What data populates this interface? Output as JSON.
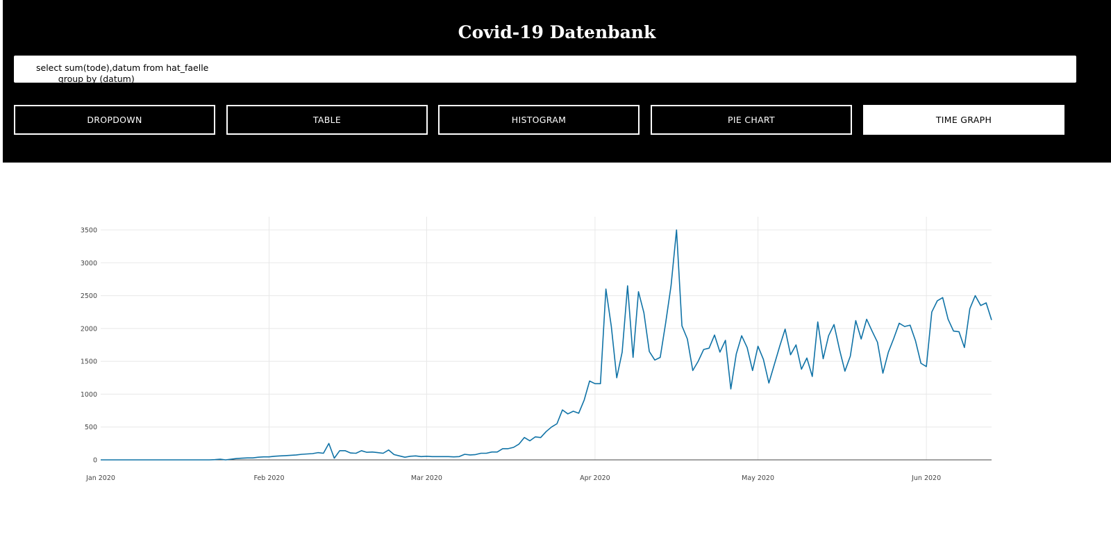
{
  "header": {
    "title": "Covid-19 Datenbank",
    "query": "select sum(tode),datum from hat_faelle\n        group by (datum)"
  },
  "buttons": [
    {
      "label": "DROPDOWN",
      "active": false
    },
    {
      "label": "TABLE",
      "active": false
    },
    {
      "label": "HISTOGRAM",
      "active": false
    },
    {
      "label": "PIE CHART",
      "active": false
    },
    {
      "label": "TIME GRAPH",
      "active": true
    }
  ],
  "chart_data": {
    "type": "line",
    "title": "",
    "xlabel": "",
    "ylabel": "",
    "line_color": "#0f72a6",
    "grid": true,
    "ylim": [
      0,
      3600
    ],
    "xlim": [
      "2020-01-01",
      "2020-06-13"
    ],
    "y_ticks": [
      0,
      500,
      1000,
      1500,
      2000,
      2500,
      3000,
      3500
    ],
    "x_ticks": [
      {
        "date": "2020-01-01",
        "label": "Jan 2020"
      },
      {
        "date": "2020-02-01",
        "label": "Feb 2020"
      },
      {
        "date": "2020-03-01",
        "label": "Mar 2020"
      },
      {
        "date": "2020-04-01",
        "label": "Apr 2020"
      },
      {
        "date": "2020-05-01",
        "label": "May 2020"
      },
      {
        "date": "2020-06-01",
        "label": "Jun 2020"
      }
    ],
    "series": [
      {
        "x": [
          "2020-01-01",
          "2020-01-02",
          "2020-01-03",
          "2020-01-04",
          "2020-01-05",
          "2020-01-06",
          "2020-01-07",
          "2020-01-08",
          "2020-01-09",
          "2020-01-10",
          "2020-01-11",
          "2020-01-12",
          "2020-01-13",
          "2020-01-14",
          "2020-01-15",
          "2020-01-16",
          "2020-01-17",
          "2020-01-18",
          "2020-01-19",
          "2020-01-20",
          "2020-01-21",
          "2020-01-22",
          "2020-01-23",
          "2020-01-24",
          "2020-01-25",
          "2020-01-26",
          "2020-01-27",
          "2020-01-28",
          "2020-01-29",
          "2020-01-30",
          "2020-01-31",
          "2020-02-01",
          "2020-02-02",
          "2020-02-03",
          "2020-02-04",
          "2020-02-05",
          "2020-02-06",
          "2020-02-07",
          "2020-02-08",
          "2020-02-09",
          "2020-02-10",
          "2020-02-11",
          "2020-02-12",
          "2020-02-13",
          "2020-02-14",
          "2020-02-15",
          "2020-02-16",
          "2020-02-17",
          "2020-02-18",
          "2020-02-19",
          "2020-02-20",
          "2020-02-21",
          "2020-02-22",
          "2020-02-23",
          "2020-02-24",
          "2020-02-25",
          "2020-02-26",
          "2020-02-27",
          "2020-02-28",
          "2020-02-29",
          "2020-03-01",
          "2020-03-02",
          "2020-03-03",
          "2020-03-04",
          "2020-03-05",
          "2020-03-06",
          "2020-03-07",
          "2020-03-08",
          "2020-03-09",
          "2020-03-10",
          "2020-03-11",
          "2020-03-12",
          "2020-03-13",
          "2020-03-14",
          "2020-03-15",
          "2020-03-16",
          "2020-03-17",
          "2020-03-18",
          "2020-03-19",
          "2020-03-20",
          "2020-03-21",
          "2020-03-22",
          "2020-03-23",
          "2020-03-24",
          "2020-03-25",
          "2020-03-26",
          "2020-03-27",
          "2020-03-28",
          "2020-03-29",
          "2020-03-30",
          "2020-03-31",
          "2020-04-01",
          "2020-04-02",
          "2020-04-03",
          "2020-04-04",
          "2020-04-05",
          "2020-04-06",
          "2020-04-07",
          "2020-04-08",
          "2020-04-09",
          "2020-04-10",
          "2020-04-11",
          "2020-04-12",
          "2020-04-13",
          "2020-04-14",
          "2020-04-15",
          "2020-04-16",
          "2020-04-17",
          "2020-04-18",
          "2020-04-19",
          "2020-04-20",
          "2020-04-21",
          "2020-04-22",
          "2020-04-23",
          "2020-04-24",
          "2020-04-25",
          "2020-04-26",
          "2020-04-27",
          "2020-04-28",
          "2020-04-29",
          "2020-04-30",
          "2020-05-01",
          "2020-05-02",
          "2020-05-03",
          "2020-05-04",
          "2020-05-05",
          "2020-05-06",
          "2020-05-07",
          "2020-05-08",
          "2020-05-09",
          "2020-05-10",
          "2020-05-11",
          "2020-05-12",
          "2020-05-13",
          "2020-05-14",
          "2020-05-15",
          "2020-05-16",
          "2020-05-17",
          "2020-05-18",
          "2020-05-19",
          "2020-05-20",
          "2020-05-21",
          "2020-05-22",
          "2020-05-23",
          "2020-05-24",
          "2020-05-25",
          "2020-05-26",
          "2020-05-27",
          "2020-05-28",
          "2020-05-29",
          "2020-05-30",
          "2020-05-31",
          "2020-06-01",
          "2020-06-02",
          "2020-06-03",
          "2020-06-04",
          "2020-06-05",
          "2020-06-06",
          "2020-06-07",
          "2020-06-08",
          "2020-06-09",
          "2020-06-10",
          "2020-06-11",
          "2020-06-12",
          "2020-06-13"
        ],
        "y": [
          0,
          0,
          0,
          0,
          0,
          0,
          0,
          0,
          0,
          0,
          0,
          0,
          0,
          0,
          0,
          0,
          0,
          0,
          0,
          0,
          0,
          3,
          10,
          0,
          10,
          20,
          25,
          30,
          30,
          40,
          45,
          45,
          55,
          60,
          65,
          70,
          75,
          85,
          90,
          95,
          110,
          100,
          250,
          25,
          140,
          140,
          105,
          100,
          140,
          115,
          120,
          110,
          100,
          150,
          80,
          60,
          40,
          55,
          60,
          50,
          55,
          50,
          50,
          50,
          50,
          45,
          50,
          85,
          75,
          80,
          100,
          100,
          120,
          120,
          170,
          170,
          190,
          240,
          340,
          290,
          350,
          340,
          430,
          500,
          550,
          760,
          700,
          740,
          710,
          910,
          1200,
          1160,
          1160,
          2600,
          2030,
          1250,
          1640,
          2650,
          1560,
          2560,
          2240,
          1650,
          1520,
          1560,
          2080,
          2650,
          3500,
          2040,
          1840,
          1360,
          1500,
          1680,
          1700,
          1900,
          1640,
          1820,
          1080,
          1610,
          1890,
          1710,
          1360,
          1730,
          1530,
          1170,
          1450,
          1730,
          1990,
          1600,
          1750,
          1380,
          1550,
          1270,
          2100,
          1540,
          1890,
          2060,
          1680,
          1350,
          1580,
          2120,
          1840,
          2140,
          1960,
          1790,
          1320,
          1640,
          1850,
          2080,
          2030,
          2050,
          1810,
          1470,
          1420,
          2250,
          2420,
          2470,
          2140,
          1960,
          1950,
          1710,
          2300,
          2500,
          2350,
          2390,
          2130
        ]
      }
    ]
  }
}
